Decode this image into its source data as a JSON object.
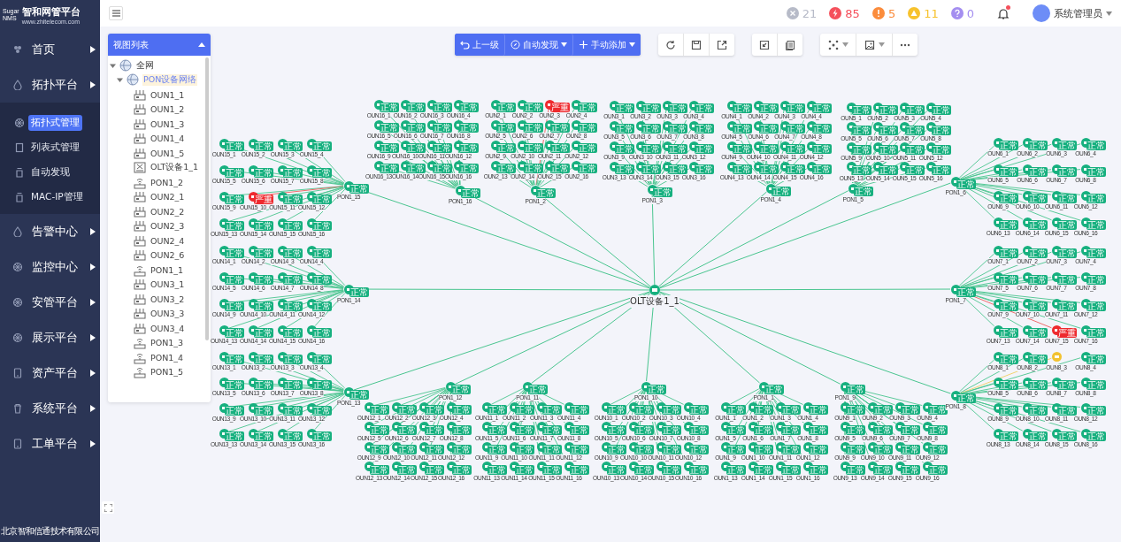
{
  "sidebar": {
    "logo": {
      "mark_top": "Sugar",
      "mark_bottom": "NMS",
      "title": "智和网管平台",
      "url": "www.zhitelecom.com"
    },
    "menu": [
      {
        "label": "首页"
      },
      {
        "label": "拓扑平台",
        "children": [
          {
            "label": "拓扑式管理",
            "selected": true
          },
          {
            "label": "列表式管理",
            "selected": false
          },
          {
            "label": "自动发现",
            "selected": false
          },
          {
            "label": "MAC-IP管理",
            "selected": false
          }
        ]
      },
      {
        "label": "告警中心"
      },
      {
        "label": "监控中心"
      },
      {
        "label": "安管平台"
      },
      {
        "label": "展示平台"
      },
      {
        "label": "资产平台"
      },
      {
        "label": "系统平台"
      },
      {
        "label": "工单平台"
      }
    ],
    "footer": "北京智和信通技术有限公司"
  },
  "header": {
    "alarms": [
      {
        "kind": "offline",
        "count": "21"
      },
      {
        "kind": "critical",
        "count": "85"
      },
      {
        "kind": "major",
        "count": "5"
      },
      {
        "kind": "minor",
        "count": "11"
      },
      {
        "kind": "unknown",
        "count": "0"
      }
    ],
    "bell": {
      "unread": true
    },
    "user": {
      "name": "系统管理员"
    }
  },
  "toolbar": {
    "actions": [
      {
        "label": "上一级",
        "kind": "back",
        "dropdown": false
      },
      {
        "label": "自动发现",
        "kind": "discover",
        "dropdown": true
      },
      {
        "label": "手动添加",
        "kind": "add",
        "dropdown": true
      }
    ]
  },
  "tree": {
    "title": "视图列表",
    "items": [
      {
        "label": "全网",
        "kind": "network",
        "expanded": true,
        "selected": false,
        "children": [
          {
            "label": "PON设备网络",
            "kind": "network",
            "expanded": true,
            "selected": true,
            "children": [
              {
                "label": "OUN1_1",
                "kind": "onu",
                "selected": false
              },
              {
                "label": "OUN1_2",
                "kind": "onu",
                "selected": false
              },
              {
                "label": "OUN1_3",
                "kind": "onu",
                "selected": false
              },
              {
                "label": "OUN1_4",
                "kind": "onu",
                "selected": false
              },
              {
                "label": "OUN1_5",
                "kind": "onu",
                "selected": false
              },
              {
                "label": "OLT设备1_1",
                "kind": "olt",
                "selected": false
              },
              {
                "label": "PON1_2",
                "kind": "pon",
                "selected": false
              },
              {
                "label": "OUN2_1",
                "kind": "onu",
                "selected": false
              },
              {
                "label": "OUN2_2",
                "kind": "onu",
                "selected": false
              },
              {
                "label": "OUN2_3",
                "kind": "onu",
                "selected": false
              },
              {
                "label": "OUN2_4",
                "kind": "onu",
                "selected": false
              },
              {
                "label": "OUN2_6",
                "kind": "onu",
                "selected": false
              },
              {
                "label": "PON1_1",
                "kind": "pon",
                "selected": false
              },
              {
                "label": "OUN3_1",
                "kind": "onu",
                "selected": false
              },
              {
                "label": "OUN3_2",
                "kind": "onu",
                "selected": false
              },
              {
                "label": "OUN3_3",
                "kind": "onu",
                "selected": false
              },
              {
                "label": "OUN3_4",
                "kind": "onu",
                "selected": false
              },
              {
                "label": "PON1_3",
                "kind": "pon",
                "selected": false
              },
              {
                "label": "PON1_4",
                "kind": "pon",
                "selected": false
              },
              {
                "label": "PON1_5",
                "kind": "pon",
                "selected": false
              }
            ]
          }
        ]
      }
    ]
  },
  "topology": {
    "olt": {
      "name": "OLT设备1_1"
    },
    "pons": [
      {
        "name": "PON1_15",
        "badge": "正常",
        "kind": "normal",
        "onus": [
          {
            "name": "OUN15_1",
            "badge": "正常",
            "kind": "normal"
          },
          {
            "name": "OUN15_2",
            "badge": "正常",
            "kind": "normal"
          },
          {
            "name": "OUN15_3",
            "badge": "正常",
            "kind": "normal"
          },
          {
            "name": "OUN15_4",
            "badge": "正常",
            "kind": "normal"
          },
          {
            "name": "OUN15_5",
            "badge": "正常",
            "kind": "normal"
          },
          {
            "name": "OUN15_6",
            "badge": "正常",
            "kind": "normal"
          },
          {
            "name": "OUN15_7",
            "badge": "正常",
            "kind": "normal"
          },
          {
            "name": "OUN15_8",
            "badge": "正常",
            "kind": "normal"
          },
          {
            "name": "OUN15_9",
            "badge": "正常",
            "kind": "normal"
          },
          {
            "name": "OUN15_10",
            "badge": "严重",
            "kind": "critical"
          },
          {
            "name": "OUN15_11",
            "badge": "正常",
            "kind": "normal"
          },
          {
            "name": "OUN15_12",
            "badge": "正常",
            "kind": "normal"
          },
          {
            "name": "OUN15_13",
            "badge": "正常",
            "kind": "normal"
          },
          {
            "name": "OUN15_14",
            "badge": "正常",
            "kind": "normal"
          },
          {
            "name": "OUN15_15",
            "badge": "正常",
            "kind": "normal"
          },
          {
            "name": "OUN15_16",
            "badge": "正常",
            "kind": "normal"
          }
        ]
      },
      {
        "name": "PON1_16",
        "badge": "正常",
        "kind": "normal",
        "onus": [
          {
            "name": "OUN16_1",
            "badge": "正常",
            "kind": "normal"
          },
          {
            "name": "OUN16_2",
            "badge": "正常",
            "kind": "normal"
          },
          {
            "name": "OUN16_3",
            "badge": "正常",
            "kind": "normal"
          },
          {
            "name": "OUN16_4",
            "badge": "正常",
            "kind": "normal"
          },
          {
            "name": "OUN16_5",
            "badge": "正常",
            "kind": "normal"
          },
          {
            "name": "OUN16_6",
            "badge": "正常",
            "kind": "normal"
          },
          {
            "name": "OUN16_7",
            "badge": "正常",
            "kind": "normal"
          },
          {
            "name": "OUN16_8",
            "badge": "正常",
            "kind": "normal"
          },
          {
            "name": "OUN16_9",
            "badge": "正常",
            "kind": "normal"
          },
          {
            "name": "OUN16_10",
            "badge": "正常",
            "kind": "normal"
          },
          {
            "name": "OUN16_11",
            "badge": "正常",
            "kind": "normal"
          },
          {
            "name": "OUN16_12",
            "badge": "正常",
            "kind": "normal"
          },
          {
            "name": "OUN16_13",
            "badge": "正常",
            "kind": "normal"
          },
          {
            "name": "OUN16_14",
            "badge": "正常",
            "kind": "normal"
          },
          {
            "name": "OUN16_15",
            "badge": "正常",
            "kind": "normal"
          },
          {
            "name": "OUN16_16",
            "badge": "正常",
            "kind": "normal"
          }
        ]
      },
      {
        "name": "PON1_2",
        "badge": "正常",
        "kind": "normal",
        "onus": [
          {
            "name": "OUN2_1",
            "badge": "正常",
            "kind": "normal"
          },
          {
            "name": "OUN2_2",
            "badge": "正常",
            "kind": "normal"
          },
          {
            "name": "OUN2_3",
            "badge": "严重",
            "kind": "critical"
          },
          {
            "name": "OUN2_4",
            "badge": "正常",
            "kind": "normal"
          },
          {
            "name": "OUN2_5",
            "badge": "正常",
            "kind": "normal"
          },
          {
            "name": "OUN2_6",
            "badge": "正常",
            "kind": "normal"
          },
          {
            "name": "OUN2_7",
            "badge": "正常",
            "kind": "normal"
          },
          {
            "name": "OUN2_8",
            "badge": "正常",
            "kind": "normal"
          },
          {
            "name": "OUN2_9",
            "badge": "正常",
            "kind": "normal"
          },
          {
            "name": "OUN2_10",
            "badge": "正常",
            "kind": "normal"
          },
          {
            "name": "OUN2_11",
            "badge": "正常",
            "kind": "normal"
          },
          {
            "name": "OUN2_12",
            "badge": "正常",
            "kind": "normal"
          },
          {
            "name": "OUN2_13",
            "badge": "正常",
            "kind": "normal"
          },
          {
            "name": "OUN2_14",
            "badge": "正常",
            "kind": "normal"
          },
          {
            "name": "OUN2_15",
            "badge": "正常",
            "kind": "normal"
          },
          {
            "name": "OUN2_16",
            "badge": "正常",
            "kind": "normal"
          }
        ]
      },
      {
        "name": "PON1_3",
        "badge": "正常",
        "kind": "normal",
        "onus": [
          {
            "name": "OUN3_1",
            "badge": "正常",
            "kind": "normal"
          },
          {
            "name": "OUN3_2",
            "badge": "正常",
            "kind": "normal"
          },
          {
            "name": "OUN3_3",
            "badge": "正常",
            "kind": "normal"
          },
          {
            "name": "OUN3_4",
            "badge": "正常",
            "kind": "normal"
          },
          {
            "name": "OUN3_5",
            "badge": "正常",
            "kind": "normal"
          },
          {
            "name": "OUN3_6",
            "badge": "正常",
            "kind": "normal"
          },
          {
            "name": "OUN3_7",
            "badge": "正常",
            "kind": "normal"
          },
          {
            "name": "OUN3_8",
            "badge": "正常",
            "kind": "normal"
          },
          {
            "name": "OUN3_9",
            "badge": "正常",
            "kind": "normal"
          },
          {
            "name": "OUN3_10",
            "badge": "正常",
            "kind": "normal"
          },
          {
            "name": "OUN3_11",
            "badge": "正常",
            "kind": "normal"
          },
          {
            "name": "OUN3_12",
            "badge": "正常",
            "kind": "normal"
          },
          {
            "name": "OUN3_13",
            "badge": "正常",
            "kind": "normal"
          },
          {
            "name": "OUN3_14",
            "badge": "正常",
            "kind": "normal"
          },
          {
            "name": "OUN3_15",
            "badge": "正常",
            "kind": "normal"
          },
          {
            "name": "OUN3_16",
            "badge": "正常",
            "kind": "normal"
          }
        ]
      },
      {
        "name": "PON1_4",
        "badge": "正常",
        "kind": "normal",
        "onus": [
          {
            "name": "OUN4_1",
            "badge": "正常",
            "kind": "normal"
          },
          {
            "name": "OUN4_2",
            "badge": "正常",
            "kind": "normal"
          },
          {
            "name": "OUN4_3",
            "badge": "正常",
            "kind": "normal"
          },
          {
            "name": "OUN4_4",
            "badge": "正常",
            "kind": "normal"
          },
          {
            "name": "OUN4_5",
            "badge": "正常",
            "kind": "normal"
          },
          {
            "name": "OUN4_6",
            "badge": "正常",
            "kind": "normal"
          },
          {
            "name": "OUN4_7",
            "badge": "正常",
            "kind": "normal"
          },
          {
            "name": "OUN4_8",
            "badge": "正常",
            "kind": "normal"
          },
          {
            "name": "OUN4_9",
            "badge": "正常",
            "kind": "normal"
          },
          {
            "name": "OUN4_10",
            "badge": "正常",
            "kind": "normal"
          },
          {
            "name": "OUN4_11",
            "badge": "正常",
            "kind": "normal"
          },
          {
            "name": "OUN4_12",
            "badge": "正常",
            "kind": "normal"
          },
          {
            "name": "OUN4_13",
            "badge": "正常",
            "kind": "normal"
          },
          {
            "name": "OUN4_14",
            "badge": "正常",
            "kind": "normal"
          },
          {
            "name": "OUN4_15",
            "badge": "正常",
            "kind": "normal"
          },
          {
            "name": "OUN4_16",
            "badge": "正常",
            "kind": "normal"
          }
        ]
      },
      {
        "name": "PON1_5",
        "badge": "正常",
        "kind": "normal",
        "onus": [
          {
            "name": "OUN5_1",
            "badge": "正常",
            "kind": "normal"
          },
          {
            "name": "OUN5_2",
            "badge": "正常",
            "kind": "normal"
          },
          {
            "name": "OUN5_3",
            "badge": "正常",
            "kind": "normal"
          },
          {
            "name": "OUN5_4",
            "badge": "正常",
            "kind": "normal"
          },
          {
            "name": "OUN5_5",
            "badge": "正常",
            "kind": "normal"
          },
          {
            "name": "OUN5_6",
            "badge": "正常",
            "kind": "normal"
          },
          {
            "name": "OUN5_7",
            "badge": "正常",
            "kind": "normal"
          },
          {
            "name": "OUN5_8",
            "badge": "正常",
            "kind": "normal"
          },
          {
            "name": "OUN5_9",
            "badge": "正常",
            "kind": "normal"
          },
          {
            "name": "OUN5_10",
            "badge": "正常",
            "kind": "normal"
          },
          {
            "name": "OUN5_11",
            "badge": "正常",
            "kind": "normal"
          },
          {
            "name": "OUN5_12",
            "badge": "正常",
            "kind": "normal"
          },
          {
            "name": "OUN5_13",
            "badge": "正常",
            "kind": "normal"
          },
          {
            "name": "OUN5_14",
            "badge": "正常",
            "kind": "normal"
          },
          {
            "name": "OUN5_15",
            "badge": "正常",
            "kind": "normal"
          },
          {
            "name": "OUN5_16",
            "badge": "正常",
            "kind": "normal"
          }
        ]
      },
      {
        "name": "PON1_6",
        "badge": "正常",
        "kind": "normal",
        "onus": [
          {
            "name": "OUN6_1",
            "badge": "正常",
            "kind": "normal"
          },
          {
            "name": "OUN6_2",
            "badge": "正常",
            "kind": "normal"
          },
          {
            "name": "OUN6_3",
            "badge": "正常",
            "kind": "normal"
          },
          {
            "name": "OUN6_4",
            "badge": "正常",
            "kind": "normal"
          },
          {
            "name": "OUN6_5",
            "badge": "正常",
            "kind": "normal"
          },
          {
            "name": "OUN6_6",
            "badge": "正常",
            "kind": "normal"
          },
          {
            "name": "OUN6_7",
            "badge": "正常",
            "kind": "normal"
          },
          {
            "name": "OUN6_8",
            "badge": "正常",
            "kind": "normal"
          },
          {
            "name": "OUN6_9",
            "badge": "正常",
            "kind": "normal"
          },
          {
            "name": "OUN6_10",
            "badge": "正常",
            "kind": "normal"
          },
          {
            "name": "OUN6_11",
            "badge": "正常",
            "kind": "normal"
          },
          {
            "name": "OUN6_12",
            "badge": "正常",
            "kind": "normal"
          },
          {
            "name": "OUN6_13",
            "badge": "正常",
            "kind": "normal"
          },
          {
            "name": "OUN6_14",
            "badge": "正常",
            "kind": "normal"
          },
          {
            "name": "OUN6_15",
            "badge": "正常",
            "kind": "normal"
          },
          {
            "name": "OUN6_16",
            "badge": "正常",
            "kind": "normal"
          }
        ]
      },
      {
        "name": "PON1_14",
        "badge": "正常",
        "kind": "normal",
        "onus": [
          {
            "name": "OUN14_1",
            "badge": "正常",
            "kind": "normal"
          },
          {
            "name": "OUN14_2",
            "badge": "正常",
            "kind": "normal"
          },
          {
            "name": "OUN14_3",
            "badge": "正常",
            "kind": "normal"
          },
          {
            "name": "OUN14_4",
            "badge": "正常",
            "kind": "normal"
          },
          {
            "name": "OUN14_5",
            "badge": "正常",
            "kind": "normal"
          },
          {
            "name": "OUN14_6",
            "badge": "正常",
            "kind": "normal"
          },
          {
            "name": "OUN14_7",
            "badge": "正常",
            "kind": "normal"
          },
          {
            "name": "OUN14_8",
            "badge": "正常",
            "kind": "normal"
          },
          {
            "name": "OUN14_9",
            "badge": "正常",
            "kind": "normal"
          },
          {
            "name": "OUN14_10",
            "badge": "正常",
            "kind": "normal"
          },
          {
            "name": "OUN14_11",
            "badge": "正常",
            "kind": "normal"
          },
          {
            "name": "OUN14_12",
            "badge": "正常",
            "kind": "normal"
          },
          {
            "name": "OUN14_13",
            "badge": "正常",
            "kind": "normal"
          },
          {
            "name": "OUN14_14",
            "badge": "正常",
            "kind": "normal"
          },
          {
            "name": "OUN14_15",
            "badge": "正常",
            "kind": "normal"
          },
          {
            "name": "OUN14_16",
            "badge": "正常",
            "kind": "normal"
          }
        ]
      },
      {
        "name": "PON1_7",
        "badge": "正常",
        "kind": "normal",
        "onus": [
          {
            "name": "OUN7_1",
            "badge": "正常",
            "kind": "normal"
          },
          {
            "name": "OUN7_2",
            "badge": "正常",
            "kind": "normal"
          },
          {
            "name": "OUN7_3",
            "badge": "正常",
            "kind": "normal"
          },
          {
            "name": "OUN7_4",
            "badge": "正常",
            "kind": "normal"
          },
          {
            "name": "OUN7_5",
            "badge": "正常",
            "kind": "normal"
          },
          {
            "name": "OUN7_6",
            "badge": "正常",
            "kind": "normal"
          },
          {
            "name": "OUN7_7",
            "badge": "正常",
            "kind": "normal"
          },
          {
            "name": "OUN7_8",
            "badge": "正常",
            "kind": "normal"
          },
          {
            "name": "OUN7_9",
            "badge": "正常",
            "kind": "normal"
          },
          {
            "name": "OUN7_10",
            "badge": "正常",
            "kind": "normal"
          },
          {
            "name": "OUN7_11",
            "badge": "正常",
            "kind": "normal"
          },
          {
            "name": "OUN7_12",
            "badge": "正常",
            "kind": "normal"
          },
          {
            "name": "OUN7_13",
            "badge": "正常",
            "kind": "normal"
          },
          {
            "name": "OUN7_14",
            "badge": "正常",
            "kind": "normal"
          },
          {
            "name": "OUN7_15",
            "badge": "严重",
            "kind": "critical"
          },
          {
            "name": "OUN7_16",
            "badge": "正常",
            "kind": "normal"
          }
        ]
      },
      {
        "name": "PON1_13",
        "badge": "正常",
        "kind": "normal",
        "onus": [
          {
            "name": "OUN13_1",
            "badge": "正常",
            "kind": "normal"
          },
          {
            "name": "OUN13_2",
            "badge": "正常",
            "kind": "normal"
          },
          {
            "name": "OUN13_3",
            "badge": "正常",
            "kind": "normal"
          },
          {
            "name": "OUN13_4",
            "badge": "正常",
            "kind": "normal"
          },
          {
            "name": "OUN13_5",
            "badge": "正常",
            "kind": "normal"
          },
          {
            "name": "OUN13_6",
            "badge": "正常",
            "kind": "normal"
          },
          {
            "name": "OUN13_7",
            "badge": "正常",
            "kind": "normal"
          },
          {
            "name": "OUN13_8",
            "badge": "正常",
            "kind": "normal"
          },
          {
            "name": "OUN13_9",
            "badge": "正常",
            "kind": "normal"
          },
          {
            "name": "OUN13_10",
            "badge": "正常",
            "kind": "normal"
          },
          {
            "name": "OUN13_11",
            "badge": "正常",
            "kind": "normal"
          },
          {
            "name": "OUN13_12",
            "badge": "正常",
            "kind": "normal"
          },
          {
            "name": "OUN13_13",
            "badge": "正常",
            "kind": "normal"
          },
          {
            "name": "OUN13_14",
            "badge": "正常",
            "kind": "normal"
          },
          {
            "name": "OUN13_15",
            "badge": "正常",
            "kind": "normal"
          },
          {
            "name": "OUN13_16",
            "badge": "正常",
            "kind": "normal"
          }
        ]
      },
      {
        "name": "PON1_12",
        "badge": "正常",
        "kind": "normal",
        "onus": [
          {
            "name": "OUN12_1",
            "badge": "正常",
            "kind": "normal"
          },
          {
            "name": "OUN12_2",
            "badge": "正常",
            "kind": "normal"
          },
          {
            "name": "OUN12_3",
            "badge": "正常",
            "kind": "normal"
          },
          {
            "name": "OUN12_4",
            "badge": "正常",
            "kind": "normal"
          },
          {
            "name": "OUN12_5",
            "badge": "正常",
            "kind": "normal"
          },
          {
            "name": "OUN12_6",
            "badge": "正常",
            "kind": "normal"
          },
          {
            "name": "OUN12_7",
            "badge": "正常",
            "kind": "normal"
          },
          {
            "name": "OUN12_8",
            "badge": "正常",
            "kind": "normal"
          },
          {
            "name": "OUN12_9",
            "badge": "正常",
            "kind": "normal"
          },
          {
            "name": "OUN12_10",
            "badge": "正常",
            "kind": "normal"
          },
          {
            "name": "OUN12_11",
            "badge": "正常",
            "kind": "normal"
          },
          {
            "name": "OUN12_12",
            "badge": "正常",
            "kind": "normal"
          },
          {
            "name": "OUN12_13",
            "badge": "正常",
            "kind": "normal"
          },
          {
            "name": "OUN12_14",
            "badge": "正常",
            "kind": "normal"
          },
          {
            "name": "OUN12_15",
            "badge": "正常",
            "kind": "normal"
          },
          {
            "name": "OUN12_16",
            "badge": "正常",
            "kind": "normal"
          }
        ]
      },
      {
        "name": "PON1_11",
        "badge": "正常",
        "kind": "normal",
        "onus": [
          {
            "name": "OUN11_1",
            "badge": "正常",
            "kind": "normal"
          },
          {
            "name": "OUN11_2",
            "badge": "正常",
            "kind": "normal"
          },
          {
            "name": "OUN11_3",
            "badge": "正常",
            "kind": "normal"
          },
          {
            "name": "OUN11_4",
            "badge": "正常",
            "kind": "normal"
          },
          {
            "name": "OUN11_5",
            "badge": "正常",
            "kind": "normal"
          },
          {
            "name": "OUN11_6",
            "badge": "正常",
            "kind": "normal"
          },
          {
            "name": "OUN11_7",
            "badge": "正常",
            "kind": "normal"
          },
          {
            "name": "OUN11_8",
            "badge": "正常",
            "kind": "normal"
          },
          {
            "name": "OUN11_9",
            "badge": "正常",
            "kind": "normal"
          },
          {
            "name": "OUN11_10",
            "badge": "正常",
            "kind": "normal"
          },
          {
            "name": "OUN11_11",
            "badge": "正常",
            "kind": "normal"
          },
          {
            "name": "OUN11_12",
            "badge": "正常",
            "kind": "normal"
          },
          {
            "name": "OUN11_13",
            "badge": "正常",
            "kind": "normal"
          },
          {
            "name": "OUN11_14",
            "badge": "正常",
            "kind": "normal"
          },
          {
            "name": "OUN11_15",
            "badge": "正常",
            "kind": "normal"
          },
          {
            "name": "OUN11_16",
            "badge": "正常",
            "kind": "normal"
          }
        ]
      },
      {
        "name": "PON1_10",
        "badge": "正常",
        "kind": "normal",
        "onus": [
          {
            "name": "OUN10_1",
            "badge": "正常",
            "kind": "normal"
          },
          {
            "name": "OUN10_2",
            "badge": "正常",
            "kind": "normal"
          },
          {
            "name": "OUN10_3",
            "badge": "正常",
            "kind": "normal"
          },
          {
            "name": "OUN10_4",
            "badge": "正常",
            "kind": "normal"
          },
          {
            "name": "OUN10_5",
            "badge": "正常",
            "kind": "normal"
          },
          {
            "name": "OUN10_6",
            "badge": "正常",
            "kind": "normal"
          },
          {
            "name": "OUN10_7",
            "badge": "正常",
            "kind": "normal"
          },
          {
            "name": "OUN10_8",
            "badge": "正常",
            "kind": "normal"
          },
          {
            "name": "OUN10_9",
            "badge": "正常",
            "kind": "normal"
          },
          {
            "name": "OUN10_10",
            "badge": "正常",
            "kind": "normal"
          },
          {
            "name": "OUN10_11",
            "badge": "正常",
            "kind": "normal"
          },
          {
            "name": "OUN10_12",
            "badge": "正常",
            "kind": "normal"
          },
          {
            "name": "OUN10_13",
            "badge": "正常",
            "kind": "normal"
          },
          {
            "name": "OUN10_14",
            "badge": "正常",
            "kind": "normal"
          },
          {
            "name": "OUN10_15",
            "badge": "正常",
            "kind": "normal"
          },
          {
            "name": "OUN10_16",
            "badge": "正常",
            "kind": "normal"
          }
        ]
      },
      {
        "name": "PON1_1",
        "badge": "正常",
        "kind": "normal",
        "onus": [
          {
            "name": "OUN1_1",
            "badge": "正常",
            "kind": "normal"
          },
          {
            "name": "OUN1_2",
            "badge": "正常",
            "kind": "normal"
          },
          {
            "name": "OUN1_3",
            "badge": "正常",
            "kind": "normal"
          },
          {
            "name": "OUN1_4",
            "badge": "正常",
            "kind": "normal"
          },
          {
            "name": "OUN1_5",
            "badge": "正常",
            "kind": "normal"
          },
          {
            "name": "OUN1_6",
            "badge": "正常",
            "kind": "normal"
          },
          {
            "name": "OUN1_7",
            "badge": "正常",
            "kind": "normal"
          },
          {
            "name": "OUN1_8",
            "badge": "正常",
            "kind": "normal"
          },
          {
            "name": "OUN1_9",
            "badge": "正常",
            "kind": "normal"
          },
          {
            "name": "OUN1_10",
            "badge": "正常",
            "kind": "normal"
          },
          {
            "name": "OUN1_11",
            "badge": "正常",
            "kind": "normal"
          },
          {
            "name": "OUN1_12",
            "badge": "正常",
            "kind": "normal"
          },
          {
            "name": "OUN1_13",
            "badge": "正常",
            "kind": "normal"
          },
          {
            "name": "OUN1_14",
            "badge": "正常",
            "kind": "normal"
          },
          {
            "name": "OUN1_15",
            "badge": "正常",
            "kind": "normal"
          },
          {
            "name": "OUN1_16",
            "badge": "正常",
            "kind": "normal"
          }
        ]
      },
      {
        "name": "PON1_9",
        "badge": "正常",
        "kind": "normal",
        "onus": [
          {
            "name": "OUN9_1",
            "badge": "正常",
            "kind": "normal"
          },
          {
            "name": "OUN9_2",
            "badge": "正常",
            "kind": "normal"
          },
          {
            "name": "OUN9_3",
            "badge": "正常",
            "kind": "normal"
          },
          {
            "name": "OUN9_4",
            "badge": "正常",
            "kind": "normal"
          },
          {
            "name": "OUN9_5",
            "badge": "正常",
            "kind": "normal"
          },
          {
            "name": "OUN9_6",
            "badge": "正常",
            "kind": "normal"
          },
          {
            "name": "OUN9_7",
            "badge": "正常",
            "kind": "normal"
          },
          {
            "name": "OUN9_8",
            "badge": "正常",
            "kind": "normal"
          },
          {
            "name": "OUN9_9",
            "badge": "正常",
            "kind": "normal"
          },
          {
            "name": "OUN9_10",
            "badge": "正常",
            "kind": "normal"
          },
          {
            "name": "OUN9_11",
            "badge": "正常",
            "kind": "normal"
          },
          {
            "name": "OUN9_12",
            "badge": "正常",
            "kind": "normal"
          },
          {
            "name": "OUN9_13",
            "badge": "正常",
            "kind": "normal"
          },
          {
            "name": "OUN9_14",
            "badge": "正常",
            "kind": "normal"
          },
          {
            "name": "OUN9_15",
            "badge": "正常",
            "kind": "normal"
          },
          {
            "name": "OUN9_16",
            "badge": "正常",
            "kind": "normal"
          }
        ]
      },
      {
        "name": "PON1_8",
        "badge": "正常",
        "kind": "normal",
        "onus": [
          {
            "name": "OUN8_1",
            "badge": "正常",
            "kind": "normal"
          },
          {
            "name": "OUN8_2",
            "badge": "正常",
            "kind": "normal"
          },
          {
            "name": "OUN8_3",
            "kind": "minor"
          },
          {
            "name": "OUN8_4",
            "badge": "正常",
            "kind": "normal"
          },
          {
            "name": "OUN8_5",
            "badge": "正常",
            "kind": "normal"
          },
          {
            "name": "OUN8_6",
            "badge": "正常",
            "kind": "normal"
          },
          {
            "name": "OUN8_7",
            "badge": "正常",
            "kind": "normal"
          },
          {
            "name": "OUN8_8",
            "badge": "正常",
            "kind": "normal"
          },
          {
            "name": "OUN8_9",
            "badge": "正常",
            "kind": "normal"
          },
          {
            "name": "OUN8_10",
            "badge": "正常",
            "kind": "normal"
          },
          {
            "name": "OUN8_11",
            "badge": "正常",
            "kind": "normal"
          },
          {
            "name": "OUN8_12",
            "badge": "正常",
            "kind": "normal"
          },
          {
            "name": "OUN8_13",
            "badge": "正常",
            "kind": "normal"
          },
          {
            "name": "OUN8_14",
            "badge": "正常",
            "kind": "normal"
          },
          {
            "name": "OUN8_15",
            "badge": "正常",
            "kind": "normal"
          },
          {
            "name": "OUN8_16",
            "badge": "正常",
            "kind": "normal"
          }
        ]
      }
    ]
  }
}
